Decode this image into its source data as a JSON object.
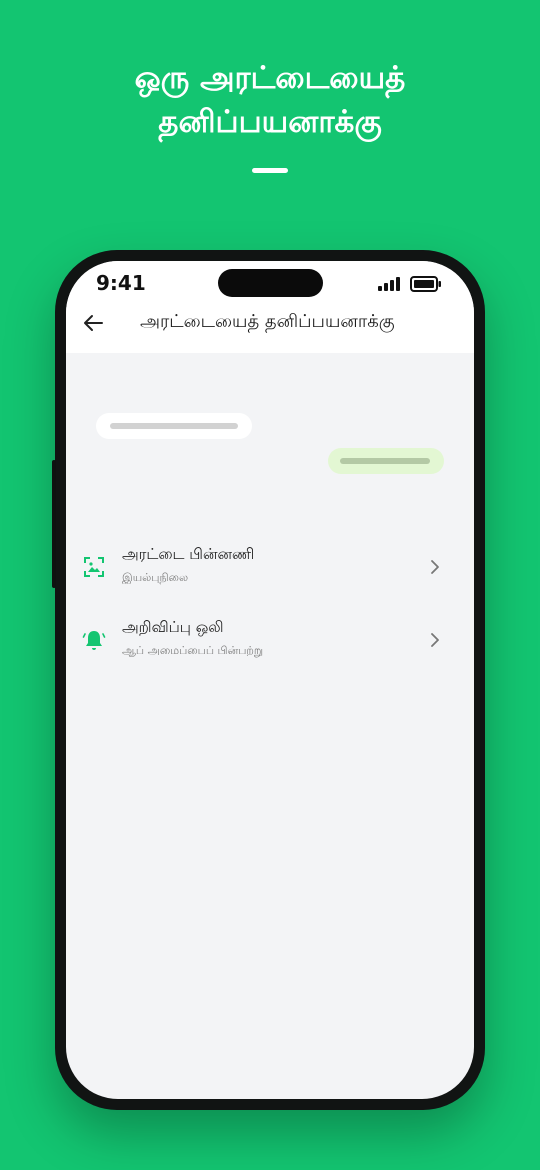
{
  "promo": {
    "title_line1": "ஒரு அரட்டையைத்",
    "title_line2": "தனிப்பயனாக்கு"
  },
  "status_bar": {
    "time": "9:41"
  },
  "header": {
    "title": "அரட்டையைத் தனிப்பயனாக்கு"
  },
  "settings": [
    {
      "label": "அரட்டை பின்னணி",
      "value": "இயல்புநிலை",
      "icon": "wallpaper-icon"
    },
    {
      "label": "அறிவிப்பு ஒலி",
      "value": "ஆப் அமைப்பைப் பின்பற்று",
      "icon": "bell-icon"
    }
  ],
  "colors": {
    "brand_green": "#13C571",
    "screen_bg": "#F3F4F6",
    "outgoing_bubble": "#E3F7D3"
  }
}
